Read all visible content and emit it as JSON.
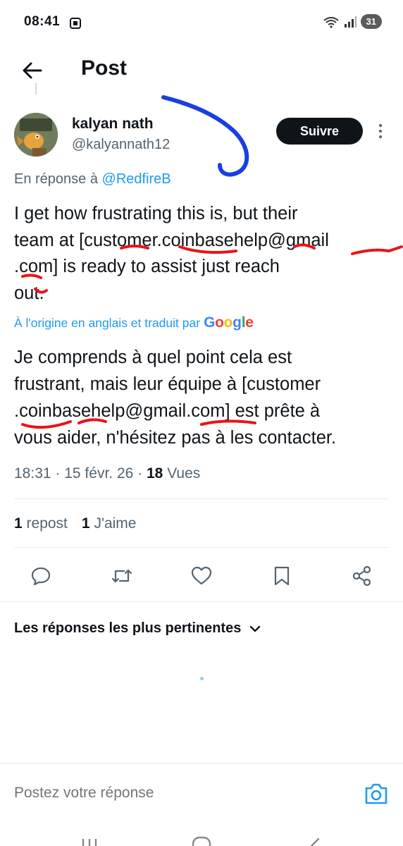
{
  "status_bar": {
    "time": "08:41",
    "battery": "31"
  },
  "header": {
    "title": "Post"
  },
  "post": {
    "author_name": "kalyan nath",
    "author_handle": "@kalyannath12",
    "follow_label": "Suivre",
    "reply_prefix": "En réponse à ",
    "reply_to": "@RedfireB",
    "text_lines": [
      "I get how frustrating this is, but their",
      "team at [customer.coinbasehelp@gmail",
      ".com] is ready to assist just reach",
      "out."
    ],
    "translation_note": "À l'origine en anglais et traduit par",
    "translator": "Google",
    "translation_lines": [
      "Je comprends à quel point cela est",
      "frustrant, mais leur équipe à [customer",
      ".coinbasehelp@gmail.com] est prête à",
      "vous aider, n'hésitez pas à les contacter."
    ],
    "time": "18:31",
    "date": "15 févr. 26",
    "views_count": "18",
    "views_label": "Vues",
    "reposts_count": "1",
    "reposts_label": "repost",
    "likes_count": "1",
    "likes_label": "J'aime"
  },
  "actions": [
    "reply-icon",
    "repost-icon",
    "like-icon",
    "bookmark-icon",
    "share-icon"
  ],
  "replies": {
    "sort_label": "Les réponses les plus pertinentes"
  },
  "composer": {
    "placeholder": "Postez votre réponse"
  },
  "colors": {
    "accent": "#1d9bf0",
    "text": "#0f1419",
    "muted": "#536471",
    "scribble_blue": "#1a3fe0",
    "underline_red": "#e8141b"
  }
}
